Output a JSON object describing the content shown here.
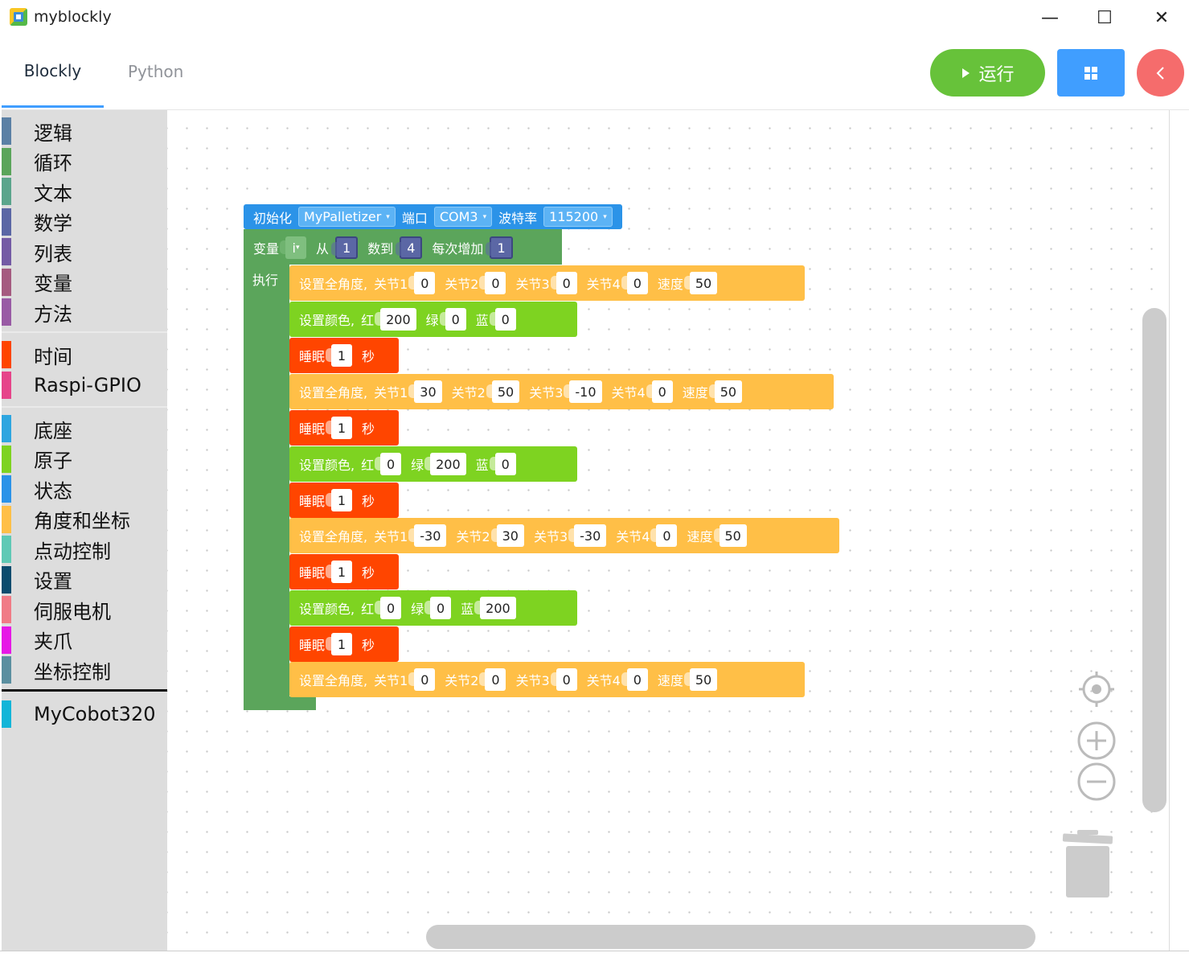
{
  "window": {
    "title": "myblockly",
    "minimize": "—",
    "maximize": "☐",
    "close": "✕"
  },
  "tabs": [
    {
      "label": "Blockly"
    },
    {
      "label": "Python"
    }
  ],
  "toolbar": {
    "run_label": "运行",
    "run_icon": "play-icon",
    "grid_icon": "grid-icon",
    "back_icon": "back-icon"
  },
  "toolbox": {
    "groups": [
      [
        {
          "label": "逻辑",
          "color": "#5b80a5"
        },
        {
          "label": "循环",
          "color": "#5ba55b"
        },
        {
          "label": "文本",
          "color": "#5ba58c"
        },
        {
          "label": "数学",
          "color": "#5b67a5"
        },
        {
          "label": "列表",
          "color": "#745ba5"
        },
        {
          "label": "变量",
          "color": "#a55b80"
        },
        {
          "label": "方法",
          "color": "#995ba5"
        }
      ],
      [
        {
          "label": "时间",
          "color": "#ff4500"
        },
        {
          "label": "Raspi-GPIO",
          "color": "#e6458a"
        }
      ],
      [
        {
          "label": "底座",
          "color": "#2ea6e0"
        },
        {
          "label": "原子",
          "color": "#7ed321"
        },
        {
          "label": "状态",
          "color": "#2b93e8"
        },
        {
          "label": "角度和坐标",
          "color": "#ffbf47"
        },
        {
          "label": "点动控制",
          "color": "#5fc9b5"
        },
        {
          "label": "设置",
          "color": "#0c4c6e"
        },
        {
          "label": "伺服电机",
          "color": "#f07b86"
        },
        {
          "label": "夹爪",
          "color": "#e619e6"
        },
        {
          "label": "坐标控制",
          "color": "#5b8fa0"
        }
      ],
      [
        {
          "label": "MyCobot320",
          "color": "#12b5d8"
        }
      ]
    ]
  },
  "program": {
    "init": {
      "label": "初始化",
      "device": "MyPalletizer",
      "port_label": "端口",
      "port": "COM3",
      "baud_label": "波特率",
      "baud": "115200"
    },
    "loop": {
      "var_label": "变量",
      "var": "i",
      "from_label": "从",
      "from": "1",
      "to_label": "数到",
      "to": "4",
      "step_label": "每次增加",
      "step": "1",
      "do_label": "执行"
    },
    "statements": [
      {
        "type": "angles",
        "label": "设置全角度,",
        "j1_label": "关节1",
        "j1": "0",
        "j2_label": "关节2",
        "j2": "0",
        "j3_label": "关节3",
        "j3": "0",
        "j4_label": "关节4",
        "j4": "0",
        "speed_label": "速度",
        "speed": "50"
      },
      {
        "type": "color",
        "label": "设置颜色,",
        "r_label": "红",
        "r": "200",
        "g_label": "绿",
        "g": "0",
        "b_label": "蓝",
        "b": "0"
      },
      {
        "type": "sleep",
        "label": "睡眠",
        "value": "1",
        "unit": "秒"
      },
      {
        "type": "angles",
        "label": "设置全角度,",
        "j1_label": "关节1",
        "j1": "30",
        "j2_label": "关节2",
        "j2": "50",
        "j3_label": "关节3",
        "j3": "-10",
        "j4_label": "关节4",
        "j4": "0",
        "speed_label": "速度",
        "speed": "50"
      },
      {
        "type": "sleep",
        "label": "睡眠",
        "value": "1",
        "unit": "秒"
      },
      {
        "type": "color",
        "label": "设置颜色,",
        "r_label": "红",
        "r": "0",
        "g_label": "绿",
        "g": "200",
        "b_label": "蓝",
        "b": "0"
      },
      {
        "type": "sleep",
        "label": "睡眠",
        "value": "1",
        "unit": "秒"
      },
      {
        "type": "angles",
        "label": "设置全角度,",
        "j1_label": "关节1",
        "j1": "-30",
        "j2_label": "关节2",
        "j2": "30",
        "j3_label": "关节3",
        "j3": "-30",
        "j4_label": "关节4",
        "j4": "0",
        "speed_label": "速度",
        "speed": "50"
      },
      {
        "type": "sleep",
        "label": "睡眠",
        "value": "1",
        "unit": "秒"
      },
      {
        "type": "color",
        "label": "设置颜色,",
        "r_label": "红",
        "r": "0",
        "g_label": "绿",
        "g": "0",
        "b_label": "蓝",
        "b": "200"
      },
      {
        "type": "sleep",
        "label": "睡眠",
        "value": "1",
        "unit": "秒"
      },
      {
        "type": "angles",
        "label": "设置全角度,",
        "j1_label": "关节1",
        "j1": "0",
        "j2_label": "关节2",
        "j2": "0",
        "j3_label": "关节3",
        "j3": "0",
        "j4_label": "关节4",
        "j4": "0",
        "speed_label": "速度",
        "speed": "50"
      }
    ]
  },
  "workspace_controls": {
    "recenter_icon": "target-icon",
    "zoom_in_icon": "zoom-in-icon",
    "zoom_out_icon": "zoom-out-icon",
    "trash_icon": "trash-icon"
  }
}
